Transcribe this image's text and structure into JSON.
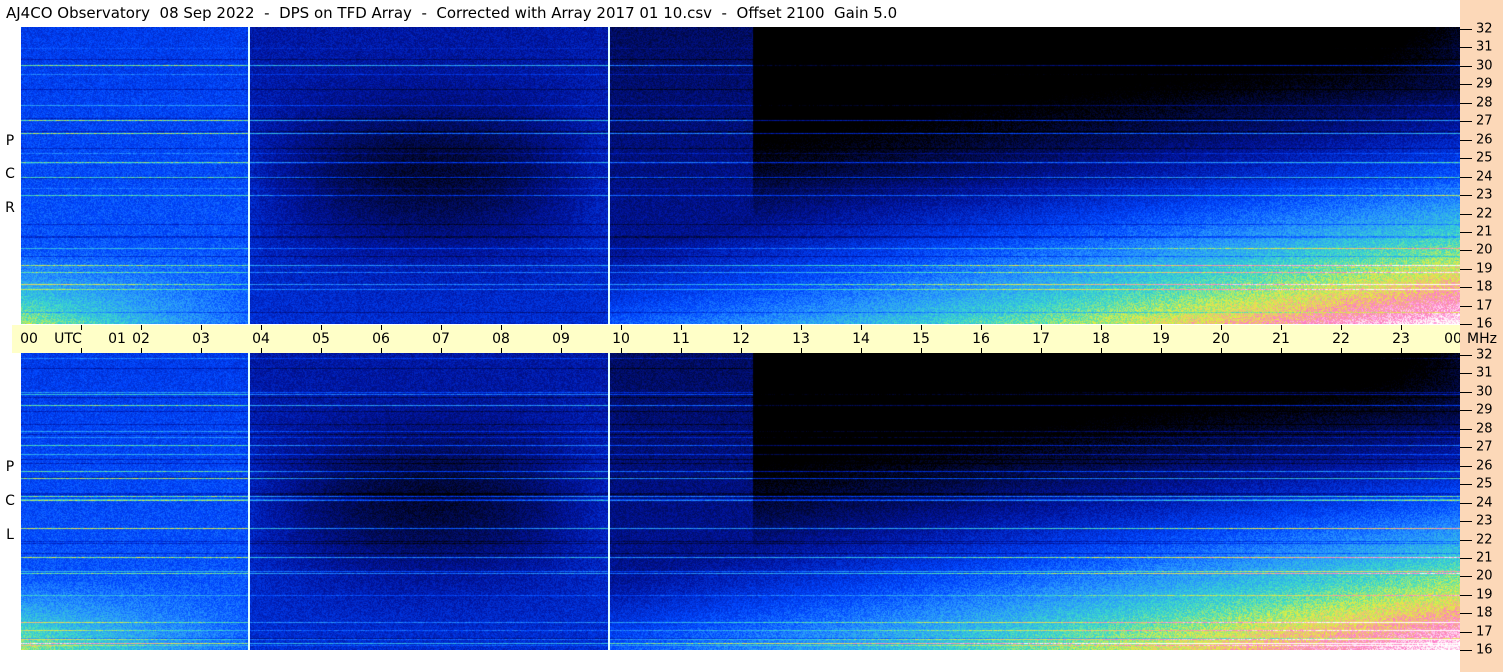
{
  "title": "AJ4CO Observatory  08 Sep 2022  -  DPS on TFD Array  -  Corrected with Array 2017 01 10.csv  -  Offset 2100  Gain 5.0",
  "panels": [
    {
      "name": "RCP",
      "letters": [
        "R",
        "C",
        "P"
      ]
    },
    {
      "name": "LCP",
      "letters": [
        "L",
        "C",
        "P"
      ]
    }
  ],
  "time_axis": {
    "labels": [
      "00",
      "UTC",
      "01",
      "02",
      "03",
      "04",
      "05",
      "06",
      "07",
      "08",
      "09",
      "10",
      "11",
      "12",
      "13",
      "14",
      "15",
      "16",
      "17",
      "18",
      "19",
      "20",
      "21",
      "22",
      "23",
      "00"
    ],
    "unit": "MHz"
  },
  "freq_axis": {
    "labels": [
      "32",
      "31",
      "30",
      "29",
      "28",
      "27",
      "26",
      "25",
      "24",
      "23",
      "22",
      "21",
      "20",
      "19",
      "18",
      "17",
      "16"
    ]
  },
  "colors": {
    "axis_band": "#ffffc8",
    "scale_strip": "#fcd8b8"
  }
}
